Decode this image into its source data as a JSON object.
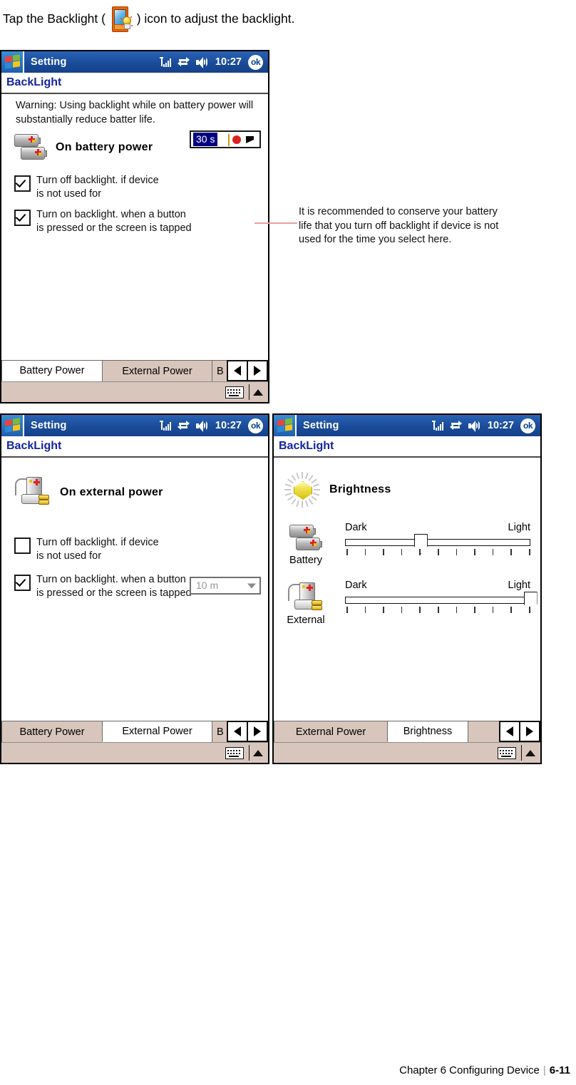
{
  "intro": {
    "before": "Tap the Backlight ( ",
    "after": " ) icon to adjust the backlight.",
    "icon": "backlight-pda-bulb-icon"
  },
  "common": {
    "app_title": "Setting",
    "clock": "10:27",
    "ok_label": "ok",
    "page_title": "BackLight",
    "icons": {
      "start": "windows-start-icon",
      "signal": "signal-strength-icon",
      "network": "network-connection-icon",
      "volume": "volume-speaker-icon",
      "keyboard": "soft-keyboard-icon",
      "sip_arrow": "sip-selector-arrow-icon",
      "prev": "scroll-left-icon",
      "next": "scroll-right-icon"
    }
  },
  "screen1": {
    "warning": "Warning: Using backlight while on battery power will substantially reduce batter life.",
    "power_label": "On battery power",
    "power_icon": "battery-pair-icon",
    "check_off": {
      "line1": "Turn off backlight. if device",
      "line2": "is not used for",
      "checked": true
    },
    "check_on": {
      "line1": "Turn on backlight. when a button",
      "line2": "is pressed or the screen is tapped",
      "checked": true
    },
    "timeout_value": "30 s",
    "timeout_selected": true,
    "timeout_disabled": false,
    "tabs": [
      {
        "label": "Battery Power",
        "active": true
      },
      {
        "label": "External Power",
        "active": false
      },
      {
        "label": "B",
        "active": false
      }
    ]
  },
  "screen2": {
    "power_label": "On external power",
    "power_icon": "external-power-plug-icon",
    "check_off": {
      "line1": "Turn off backlight. if device",
      "line2": "is not used for",
      "checked": false
    },
    "check_on": {
      "line1": "Turn on backlight. when a button",
      "line2": "is pressed or the screen is tapped",
      "checked": true
    },
    "timeout_value": "10 m",
    "timeout_selected": false,
    "timeout_disabled": true,
    "tabs": [
      {
        "label": "Battery Power",
        "active": false
      },
      {
        "label": "External Power",
        "active": true
      },
      {
        "label": "B",
        "active": false
      }
    ]
  },
  "screen3": {
    "heading": "Brightness",
    "heading_icon": "sun-brightness-icon",
    "sliders": [
      {
        "name": "Battery",
        "icon": "battery-pair-icon",
        "min_label": "Dark",
        "max_label": "Light",
        "value": 5,
        "min": 1,
        "max": 11,
        "ticks": 11
      },
      {
        "name": "External",
        "icon": "external-power-plug-icon",
        "min_label": "Dark",
        "max_label": "Light",
        "value": 11,
        "min": 1,
        "max": 11,
        "ticks": 11
      }
    ],
    "tabs": [
      {
        "label": "External Power",
        "active": false
      },
      {
        "label": "Brightness",
        "active": true
      }
    ]
  },
  "callout": {
    "text": "It is recommended to conserve your battery life that you turn off backlight if device is not used for the time you select here."
  },
  "footer": {
    "chapter": "Chapter 6 Configuring Device",
    "divider": "|",
    "page": "6-11"
  },
  "colors": {
    "titlebar": "#1d4f9c",
    "page_title": "#15249e",
    "tabbar": "#d8c6bc",
    "selection": "#000080",
    "callout_line": "#e8a0a0"
  }
}
